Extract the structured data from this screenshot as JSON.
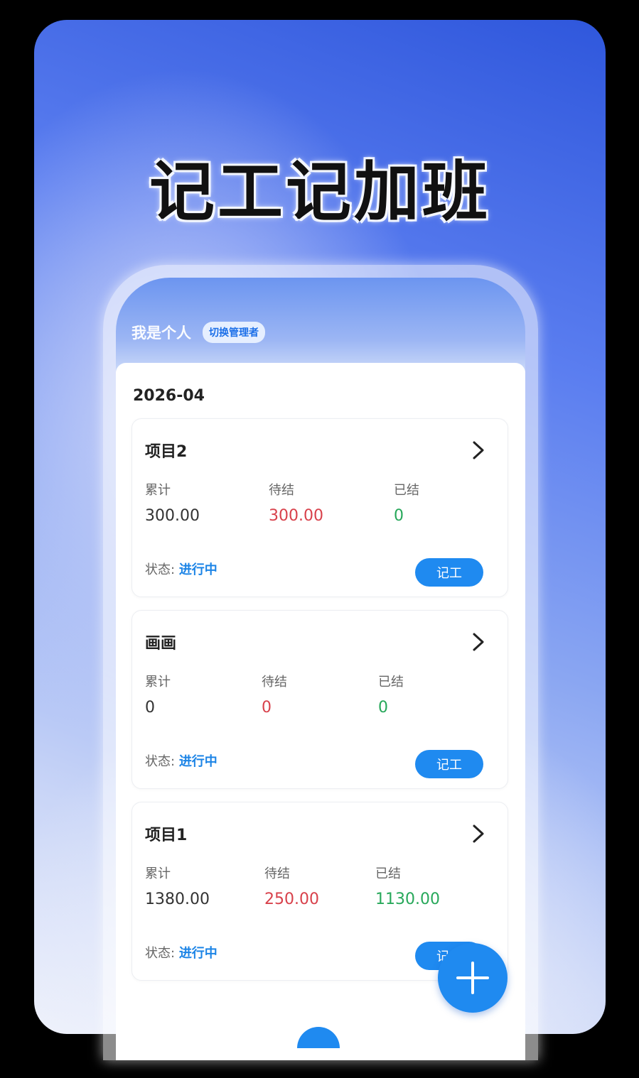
{
  "headline": "记工记加班",
  "topbar": {
    "role": "我是个人",
    "switch_label": "切换管理者"
  },
  "month": "2026-04",
  "stat_labels": {
    "total": "累计",
    "pending": "待结",
    "settled": "已结"
  },
  "status_label": "状态:",
  "record_label": "记工",
  "projects": [
    {
      "name": "项目2",
      "total": "300.00",
      "pending": "300.00",
      "settled": "0",
      "status": "进行中"
    },
    {
      "name": "画画",
      "total": "0",
      "pending": "0",
      "settled": "0",
      "status": "进行中"
    },
    {
      "name": "项目1",
      "total": "1380.00",
      "pending": "250.00",
      "settled": "1130.00",
      "status": "进行中"
    }
  ],
  "colors": {
    "accent": "#1f8af0",
    "pending": "#d8414b",
    "settled": "#27a85a",
    "status": "#1c84e6"
  },
  "icons": {
    "chevron": "chevron-right-icon",
    "fab": "plus-icon"
  }
}
